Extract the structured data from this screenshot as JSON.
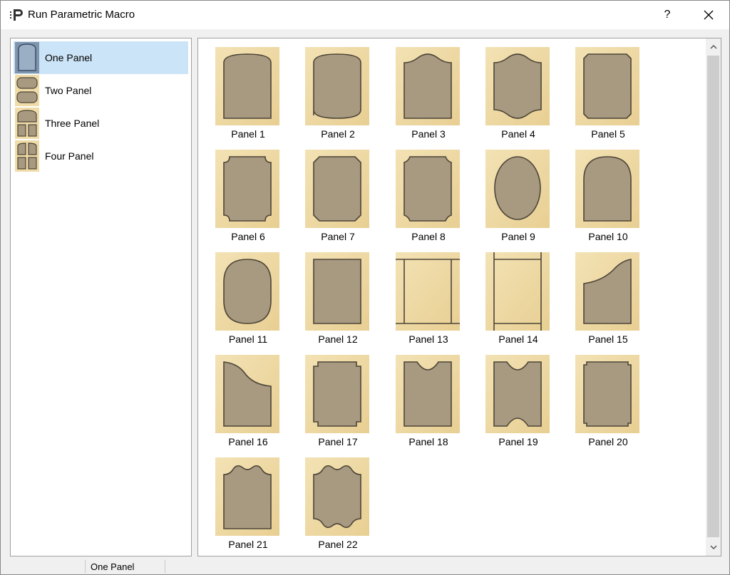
{
  "window": {
    "title": "Run Parametric Macro",
    "help_label": "?",
    "close_label": "✕"
  },
  "sidebar": {
    "items": [
      {
        "label": "One Panel",
        "selected": true
      },
      {
        "label": "Two Panel",
        "selected": false
      },
      {
        "label": "Three Panel",
        "selected": false
      },
      {
        "label": "Four Panel",
        "selected": false
      }
    ]
  },
  "panels": [
    {
      "label": "Panel 1",
      "shape": "arch-top"
    },
    {
      "label": "Panel 2",
      "shape": "arch-both"
    },
    {
      "label": "Panel 3",
      "shape": "hump-top"
    },
    {
      "label": "Panel 4",
      "shape": "hump-both"
    },
    {
      "label": "Panel 5",
      "shape": "chamfer"
    },
    {
      "label": "Panel 6",
      "shape": "notch-round"
    },
    {
      "label": "Panel 7",
      "shape": "notch-chamfer"
    },
    {
      "label": "Panel 8",
      "shape": "notch-concave"
    },
    {
      "label": "Panel 9",
      "shape": "oval"
    },
    {
      "label": "Panel 10",
      "shape": "cathedral"
    },
    {
      "label": "Panel 11",
      "shape": "rounded-oval"
    },
    {
      "label": "Panel 12",
      "shape": "rect"
    },
    {
      "label": "Panel 13",
      "shape": "frame-h"
    },
    {
      "label": "Panel 14",
      "shape": "frame-v"
    },
    {
      "label": "Panel 15",
      "shape": "wave-right"
    },
    {
      "label": "Panel 16",
      "shape": "wave-left"
    },
    {
      "label": "Panel 17",
      "shape": "ear-square"
    },
    {
      "label": "Panel 18",
      "shape": "scoop-top"
    },
    {
      "label": "Panel 19",
      "shape": "scoop-both"
    },
    {
      "label": "Panel 20",
      "shape": "ear-tab"
    },
    {
      "label": "Panel 21",
      "shape": "double-hump-top"
    },
    {
      "label": "Panel 22",
      "shape": "double-hump-both"
    }
  ],
  "statusbar": {
    "text": "One Panel"
  },
  "colors": {
    "wood_light": "#f3e2b4",
    "wood_dark": "#e8cf93",
    "panel_fill": "#a89a80",
    "panel_stroke": "#4d4538",
    "selection": "#cce4f7"
  }
}
